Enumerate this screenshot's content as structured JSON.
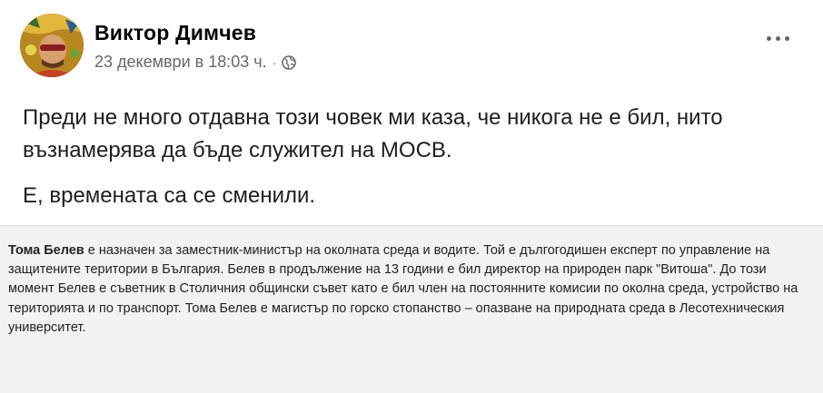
{
  "post": {
    "author": "Виктор Димчев",
    "timestamp": "23 декември в 18:03 ч.",
    "separator": "·",
    "privacy_icon": "globe-icon",
    "more_icon": "more-options-icon",
    "paragraphs": [
      "Преди не много отдавна този човек ми каза, че никога не е бил, нито възнамерява да бъде служител на МОСВ.",
      "Е, времената са се сменили."
    ]
  },
  "article": {
    "name": "Тома Белев",
    "text": " е назначен за заместник-министър на околната среда и водите. Той е дългогодишен експерт по управление на защитените територии в България. Белев в продължение на 13 години е бил директор на природен парк \"Витоша\". До този момент Белев е съветник в Столичния общински съвет като е бил член на постоянните комисии по околна среда, устройство на територията и по транспорт. Тома Белев е магистър по горско стопанство – опазване на природната среда в Лесотехническия университет."
  },
  "colors": {
    "author": "#050505",
    "meta": "#65676b",
    "post_text": "#1c1e21",
    "article_bg": "#f2f2f2"
  }
}
